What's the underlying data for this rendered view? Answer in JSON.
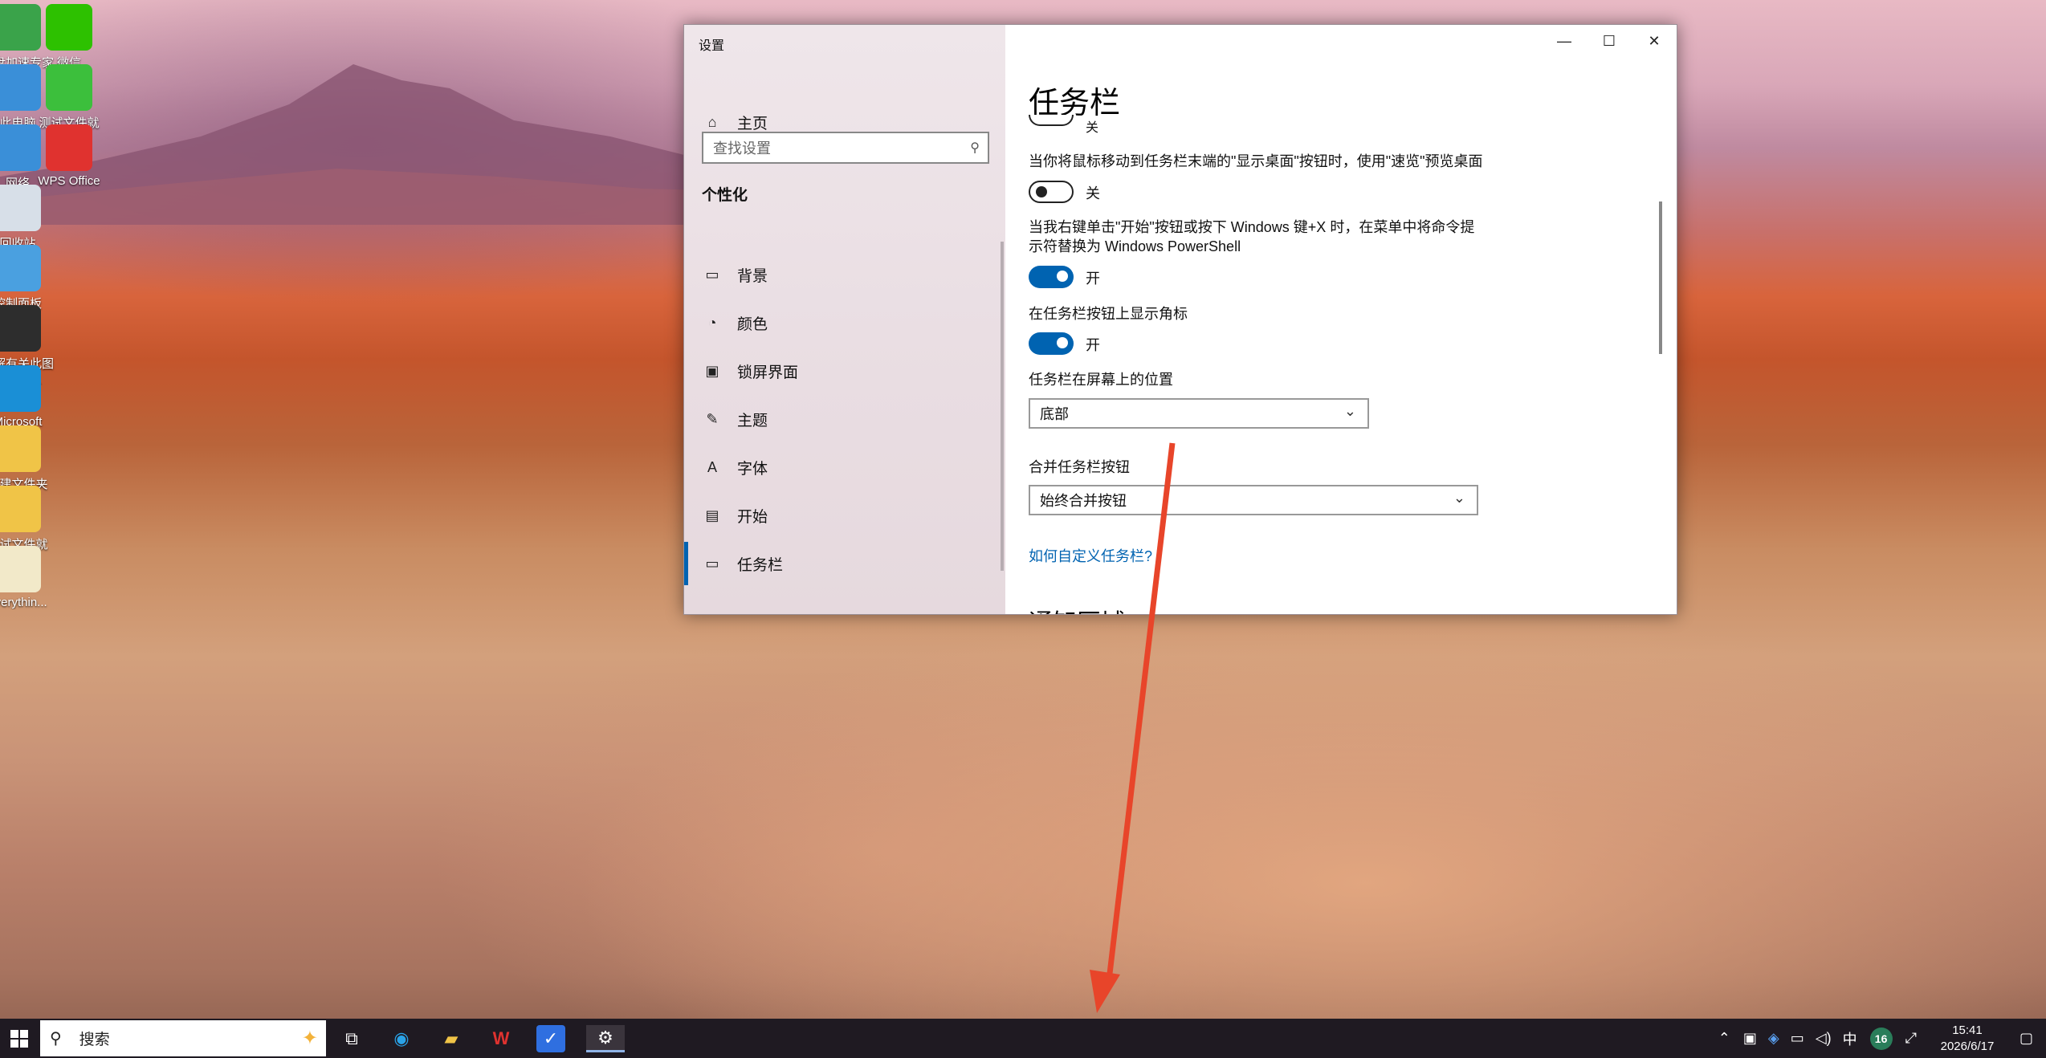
{
  "desktop": {
    "icons": [
      {
        "label": "磁盘加速专家",
        "name": "disk-accelerator-icon",
        "color": "#3aa34a"
      },
      {
        "label": "微信",
        "name": "wechat-icon",
        "color": "#2dc100"
      },
      {
        "label": "此电脑",
        "name": "this-pc-icon",
        "color": "#3a8fd8"
      },
      {
        "label": "测试文件就",
        "name": "test-file-icon",
        "color": "#3cbf3c"
      },
      {
        "label": "网络",
        "name": "network-icon",
        "color": "#3a8fd8"
      },
      {
        "label": "WPS Office",
        "name": "wps-office-icon",
        "color": "#e0322f"
      },
      {
        "label": "回收站",
        "name": "recycle-bin-icon",
        "color": "#d7dfe8"
      },
      {
        "label": "控制面板",
        "name": "control-panel-icon",
        "color": "#4aa0e0"
      },
      {
        "label": "了解有关此图片的信息",
        "name": "picture-info-icon",
        "color": "#2d2d2d"
      },
      {
        "label": "Microsoft Edge",
        "name": "edge-icon",
        "color": "#1a8fd6"
      },
      {
        "label": "新建文件夹",
        "name": "new-folder-icon",
        "color": "#f0c447"
      },
      {
        "label": "测试文件就",
        "name": "test-folder-icon",
        "color": "#f0c447"
      },
      {
        "label": "everythin...",
        "name": "everything-icon",
        "color": "#f2e9c9"
      }
    ]
  },
  "window": {
    "title": "设置",
    "sidebar": {
      "home": "主页",
      "search_placeholder": "查找设置",
      "section": "个性化",
      "items": [
        {
          "label": "背景",
          "icon": "image-icon",
          "glyph": "▭"
        },
        {
          "label": "颜色",
          "icon": "palette-icon",
          "glyph": "◔"
        },
        {
          "label": "锁屏界面",
          "icon": "lockscreen-icon",
          "glyph": "▣"
        },
        {
          "label": "主题",
          "icon": "theme-icon",
          "glyph": "✎"
        },
        {
          "label": "字体",
          "icon": "font-icon",
          "glyph": "A"
        },
        {
          "label": "开始",
          "icon": "start-icon",
          "glyph": "▤"
        },
        {
          "label": "任务栏",
          "icon": "taskbar-icon",
          "glyph": "▭"
        }
      ]
    },
    "main": {
      "heading": "任务栏",
      "partial_toggle_state": "关",
      "settings": [
        {
          "label": "当你将鼠标移动到任务栏末端的\"显示桌面\"按钮时，使用\"速览\"预览桌面",
          "state": "关",
          "on": false
        },
        {
          "label": "当我右键单击\"开始\"按钮或按下 Windows 键+X 时，在菜单中将命令提示符替换为 Windows PowerShell",
          "state": "开",
          "on": true
        },
        {
          "label": "在任务栏按钮上显示角标",
          "state": "开",
          "on": true
        }
      ],
      "position_label": "任务栏在屏幕上的位置",
      "position_value": "底部",
      "combine_label": "合并任务栏按钮",
      "combine_value": "始终合并按钮",
      "help_link": "如何自定义任务栏?",
      "next_section": "通知区域"
    }
  },
  "taskbar": {
    "search_placeholder": "搜索",
    "apps": [
      "task-view-icon",
      "edge-icon",
      "file-explorer-icon",
      "wps-icon",
      "security-icon",
      "settings-icon"
    ],
    "tray": {
      "ime": "中",
      "badge": "16",
      "time": "15:41",
      "date": "2026/6/17"
    }
  },
  "annotation_color": "#e8452a"
}
